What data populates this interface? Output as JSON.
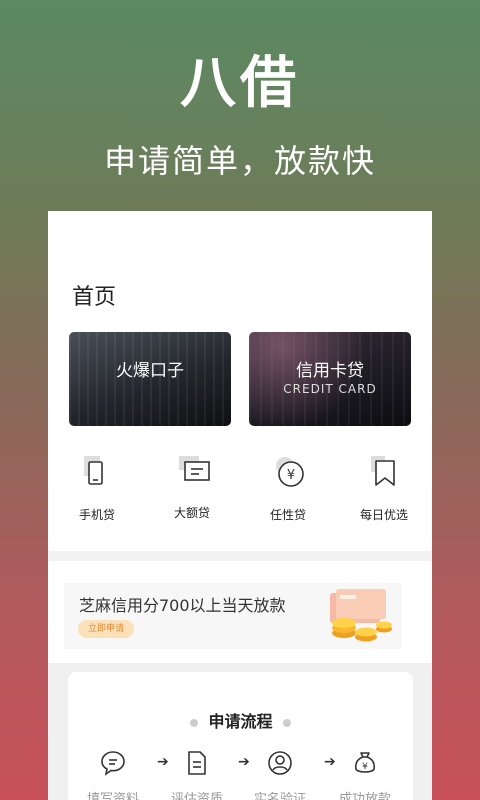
{
  "hero": {
    "title": "八借",
    "subtitle": "申请简单，放款快"
  },
  "home": {
    "title": "首页",
    "banners": [
      {
        "title": "火爆口子",
        "subtitle": ""
      },
      {
        "title": "信用卡贷",
        "subtitle": "CREDIT CARD"
      }
    ],
    "categories": [
      {
        "label": "手机贷",
        "icon": "phone-icon"
      },
      {
        "label": "大额贷",
        "icon": "card-icon"
      },
      {
        "label": "任性贷",
        "icon": "yen-icon"
      },
      {
        "label": "每日优选",
        "icon": "bookmark-icon"
      }
    ],
    "promo": {
      "text": "芝麻信用分700以上当天放款",
      "button": "立即申请"
    },
    "flow": {
      "title": "申请流程",
      "steps": [
        {
          "label": "填写资料",
          "icon": "chat-icon"
        },
        {
          "label": "评估资质",
          "icon": "document-icon"
        },
        {
          "label": "实名验证",
          "icon": "user-icon"
        },
        {
          "label": "成功放款",
          "icon": "money-bag-icon"
        }
      ],
      "arrow": "➔"
    }
  },
  "colors": {
    "gradient_top": "#5b8a63",
    "gradient_bottom": "#c8505a",
    "promo_button_bg": "#fbe0b9",
    "promo_button_text": "#e08a2e"
  }
}
